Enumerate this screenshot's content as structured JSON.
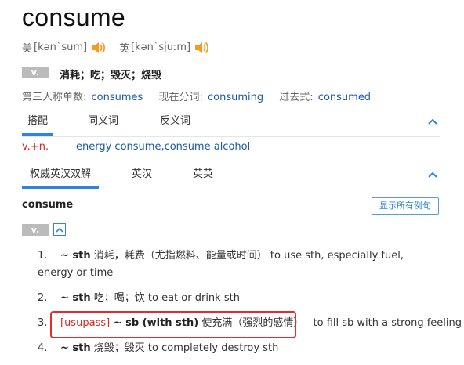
{
  "word": "consume",
  "pron": {
    "us_label": "美",
    "us_ipa": "[kən`sum]",
    "uk_label": "英",
    "uk_ipa": "[kən`sjuːm]"
  },
  "pos": "v.",
  "definition_cn": "消耗；吃；毁灭；烧毁",
  "forms": {
    "third_person_label": "第三人称单数:",
    "third_person": "consumes",
    "present_participle_label": "现在分词:",
    "present_participle": "consuming",
    "past_label": "过去式:",
    "past": "consumed"
  },
  "tabs1": [
    "搭配",
    "同义词",
    "反义词"
  ],
  "collocation_type": "v.+n.",
  "collocations": "energy consume,consume alcohol",
  "tabs2": [
    "权威英汉双解",
    "英汉",
    "英英"
  ],
  "entry_head": "consume",
  "show_all_button": "显示所有例句",
  "entry_pos": "v.",
  "senses": [
    {
      "num": "1.",
      "tag": "",
      "head": "~ sth",
      "cn": " 消耗，耗费（尤指燃料、能量或时间）",
      "en": " to use sth, especially fuel, energy or time"
    },
    {
      "num": "2.",
      "tag": "",
      "head": "~ sth",
      "cn": " 吃；喝；饮",
      "en": " to eat or drink sth"
    },
    {
      "num": "3.",
      "tag": "[usupass]",
      "head": " ~ sb (with sth)",
      "cn": " 使充满（强烈的感情）",
      "en": " to fill sb with a strong feeling"
    },
    {
      "num": "4.",
      "tag": "",
      "head": "~ sth",
      "cn": " 烧毁；毁灭",
      "en": " to completely destroy sth"
    }
  ],
  "colors": {
    "accent_blue": "#2d86d9",
    "link_blue": "#1a5aa6",
    "speaker_orange": "#f59a23",
    "highlight_red": "#e52b2b",
    "badge_gray": "#bbbbbb"
  }
}
